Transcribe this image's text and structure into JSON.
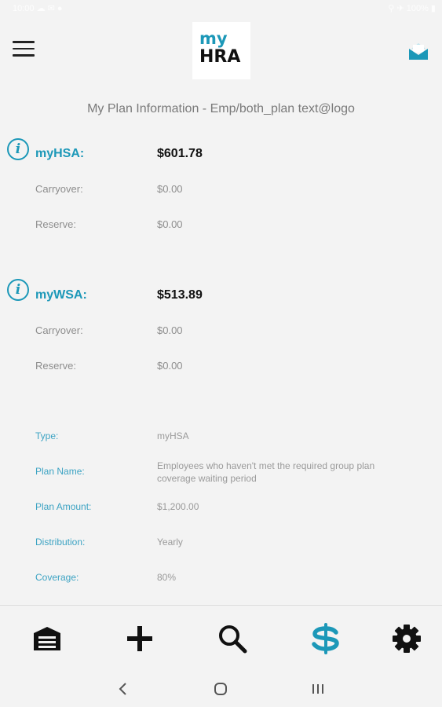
{
  "status_bar": {
    "left_text": "10:00 ☁ ✉ ●",
    "right_text": "⚲ ✈ 100% ▮"
  },
  "header": {
    "logo_line1": "my",
    "logo_line2": "HRA"
  },
  "page": {
    "title": "My Plan Information - Emp/both_plan text@logo"
  },
  "accounts": [
    {
      "name": "myHSA:",
      "amount": "$601.78",
      "carryover_label": "Carryover:",
      "carryover_value": "$0.00",
      "reserve_label": "Reserve:",
      "reserve_value": "$0.00"
    },
    {
      "name": "myWSA:",
      "amount": "$513.89",
      "carryover_label": "Carryover:",
      "carryover_value": "$0.00",
      "reserve_label": "Reserve:",
      "reserve_value": "$0.00"
    }
  ],
  "details": [
    {
      "label": "Type:",
      "value": "myHSA"
    },
    {
      "label": "Plan Name:",
      "value": "Employees who haven't met the required group plan coverage waiting period"
    },
    {
      "label": "Plan Amount:",
      "value": "$1,200.00"
    },
    {
      "label": "Distribution:",
      "value": "Yearly"
    },
    {
      "label": "Coverage:",
      "value": "80%"
    }
  ],
  "tabs": [
    {
      "icon": "home-icon",
      "active": false
    },
    {
      "icon": "add-icon",
      "active": false
    },
    {
      "icon": "search-icon",
      "active": false
    },
    {
      "icon": "dollar-icon",
      "active": true
    },
    {
      "icon": "gear-icon",
      "active": false
    }
  ],
  "colors": {
    "accent": "#1c98b8",
    "background": "#f3f3f3",
    "text_muted": "#8d8d8d",
    "detail_label": "#3ca3c3"
  }
}
